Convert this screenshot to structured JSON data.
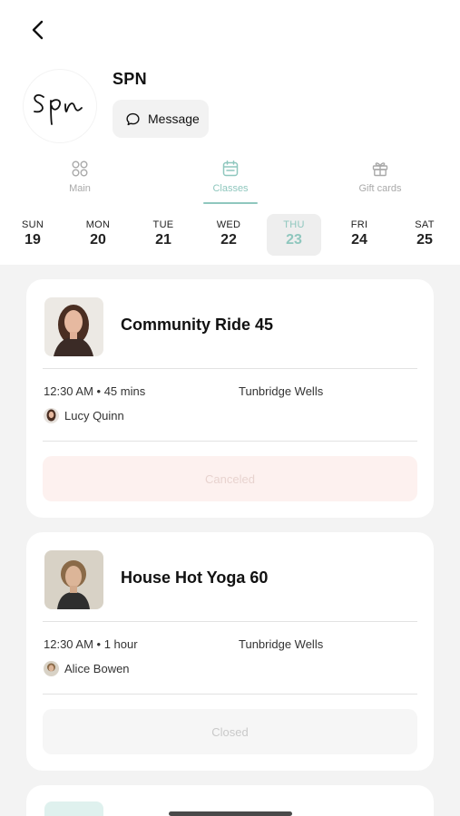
{
  "header": {
    "back_icon": "chevron-left-icon",
    "studio_name": "SPN",
    "message_label": "Message",
    "message_icon": "chat-bubble-icon"
  },
  "nav_tabs": [
    {
      "label": "Main",
      "icon": "grid-icon",
      "active": false
    },
    {
      "label": "Classes",
      "icon": "calendar-icon",
      "active": true
    },
    {
      "label": "Gift cards",
      "icon": "gift-icon",
      "active": false
    }
  ],
  "days": [
    {
      "dow": "SUN",
      "num": "19"
    },
    {
      "dow": "MON",
      "num": "20"
    },
    {
      "dow": "TUE",
      "num": "21"
    },
    {
      "dow": "WED",
      "num": "22"
    },
    {
      "dow": "THU",
      "num": "23",
      "selected": true
    },
    {
      "dow": "FRI",
      "num": "24"
    },
    {
      "dow": "SAT",
      "num": "25"
    }
  ],
  "classes": [
    {
      "title": "Community Ride 45",
      "time": "12:30 AM • 45 mins",
      "location": "Tunbridge Wells",
      "instructor": "Lucy Quinn",
      "status": "Canceled"
    },
    {
      "title": "House Hot Yoga 60",
      "time": "12:30 AM • 1 hour",
      "location": "Tunbridge Wells",
      "instructor": "Alice Bowen",
      "status": "Closed"
    }
  ],
  "colors": {
    "accent": "#8fc7be",
    "content_bg": "#f3f3f3",
    "canceled_bg": "#fdf1ef",
    "closed_bg": "#f6f6f6"
  }
}
